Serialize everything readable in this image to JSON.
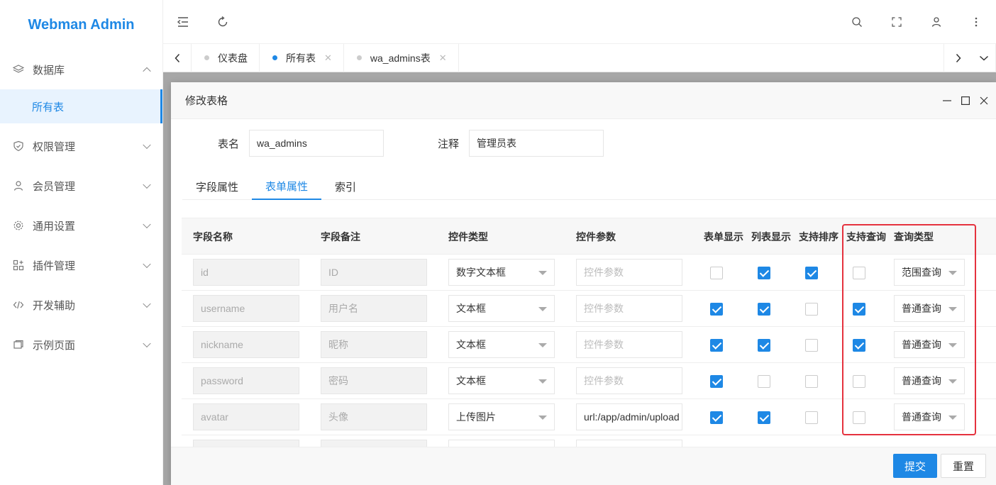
{
  "app": {
    "title": "Webman Admin"
  },
  "sidebar": {
    "items": [
      {
        "label": "数据库",
        "icon": "layers-icon",
        "expanded": true
      },
      {
        "label": "权限管理",
        "icon": "shield-icon"
      },
      {
        "label": "会员管理",
        "icon": "user-icon"
      },
      {
        "label": "通用设置",
        "icon": "gear-icon"
      },
      {
        "label": "插件管理",
        "icon": "plugin-icon"
      },
      {
        "label": "开发辅助",
        "icon": "code-icon"
      },
      {
        "label": "示例页面",
        "icon": "page-icon"
      }
    ],
    "active_sub": "所有表"
  },
  "tabs": [
    {
      "label": "仪表盘",
      "closable": false
    },
    {
      "label": "所有表",
      "closable": true,
      "active": true
    },
    {
      "label": "wa_admins表",
      "closable": true
    }
  ],
  "modal": {
    "title": "修改表格",
    "table_name_label": "表名",
    "table_name_value": "wa_admins",
    "comment_label": "注释",
    "comment_value": "管理员表",
    "tabs": [
      "字段属性",
      "表单属性",
      "索引"
    ],
    "active_tab": "表单属性",
    "submit": "提交",
    "reset": "重置"
  },
  "grid": {
    "columns": [
      "字段名称",
      "字段备注",
      "控件类型",
      "控件参数",
      "表单显示",
      "列表显示",
      "支持排序",
      "支持查询",
      "查询类型"
    ],
    "rows": [
      {
        "name": "id",
        "comment": "ID",
        "control": "数字文本框",
        "param": "控件参数",
        "param_placeholder": true,
        "form_show": false,
        "list_show": true,
        "sortable": true,
        "searchable": false,
        "search_type": "范围查询"
      },
      {
        "name": "username",
        "comment": "用户名",
        "control": "文本框",
        "param": "控件参数",
        "param_placeholder": true,
        "form_show": true,
        "list_show": true,
        "sortable": false,
        "searchable": true,
        "search_type": "普通查询"
      },
      {
        "name": "nickname",
        "comment": "昵称",
        "control": "文本框",
        "param": "控件参数",
        "param_placeholder": true,
        "form_show": true,
        "list_show": true,
        "sortable": false,
        "searchable": true,
        "search_type": "普通查询"
      },
      {
        "name": "password",
        "comment": "密码",
        "control": "文本框",
        "param": "控件参数",
        "param_placeholder": true,
        "form_show": true,
        "list_show": false,
        "sortable": false,
        "searchable": false,
        "search_type": "普通查询"
      },
      {
        "name": "avatar",
        "comment": "头像",
        "control": "上传图片",
        "param": "url:/app/admin/upload",
        "param_placeholder": false,
        "form_show": true,
        "list_show": true,
        "sortable": false,
        "searchable": false,
        "search_type": "普通查询"
      }
    ]
  },
  "colors": {
    "accent": "#1e88e5",
    "highlight": "#e5323e"
  }
}
